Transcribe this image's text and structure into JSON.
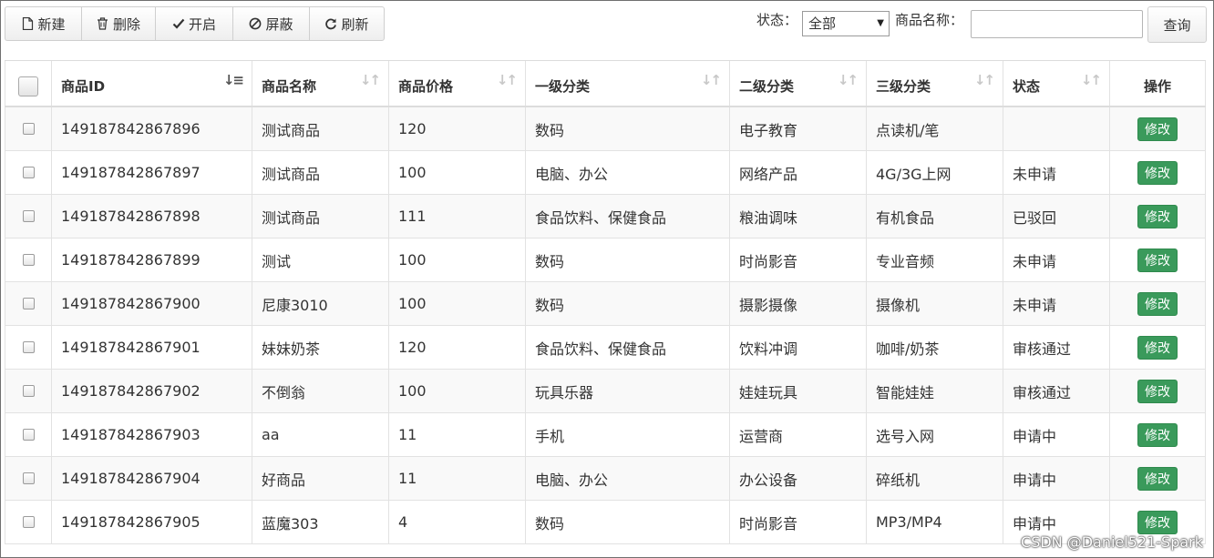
{
  "toolbar": {
    "buttons": [
      {
        "label": "新建",
        "icon": "file-icon"
      },
      {
        "label": "删除",
        "icon": "trash-icon"
      },
      {
        "label": "开启",
        "icon": "check-icon"
      },
      {
        "label": "屏蔽",
        "icon": "ban-icon"
      },
      {
        "label": "刷新",
        "icon": "refresh-icon"
      }
    ]
  },
  "filter": {
    "status_label": "状态：",
    "status_value": "全部",
    "name_label": "商品名称：",
    "name_value": "",
    "query_label": "查询"
  },
  "table": {
    "headers": [
      "商品ID",
      "商品名称",
      "商品价格",
      "一级分类",
      "二级分类",
      "三级分类",
      "状态",
      "操作"
    ],
    "edit_label": "修改",
    "rows": [
      {
        "id": "149187842867896",
        "name": "测试商品",
        "price": "120",
        "cat1": "数码",
        "cat2": "电子教育",
        "cat3": "点读机/笔",
        "status": ""
      },
      {
        "id": "149187842867897",
        "name": "测试商品",
        "price": "100",
        "cat1": "电脑、办公",
        "cat2": "网络产品",
        "cat3": "4G/3G上网",
        "status": "未申请"
      },
      {
        "id": "149187842867898",
        "name": "测试商品",
        "price": "111",
        "cat1": "食品饮料、保健食品",
        "cat2": "粮油调味",
        "cat3": "有机食品",
        "status": "已驳回"
      },
      {
        "id": "149187842867899",
        "name": "测试",
        "price": "100",
        "cat1": "数码",
        "cat2": "时尚影音",
        "cat3": "专业音频",
        "status": "未申请"
      },
      {
        "id": "149187842867900",
        "name": "尼康3010",
        "price": "100",
        "cat1": "数码",
        "cat2": "摄影摄像",
        "cat3": "摄像机",
        "status": "未申请"
      },
      {
        "id": "149187842867901",
        "name": "妹妹奶茶",
        "price": "120",
        "cat1": "食品饮料、保健食品",
        "cat2": "饮料冲调",
        "cat3": "咖啡/奶茶",
        "status": "审核通过"
      },
      {
        "id": "149187842867902",
        "name": "不倒翁",
        "price": "100",
        "cat1": "玩具乐器",
        "cat2": "娃娃玩具",
        "cat3": "智能娃娃",
        "status": "审核通过"
      },
      {
        "id": "149187842867903",
        "name": "aa",
        "price": "11",
        "cat1": "手机",
        "cat2": "运营商",
        "cat3": "选号入网",
        "status": "申请中"
      },
      {
        "id": "149187842867904",
        "name": "好商品",
        "price": "11",
        "cat1": "电脑、办公",
        "cat2": "办公设备",
        "cat3": "碎纸机",
        "status": "申请中"
      },
      {
        "id": "149187842867905",
        "name": "蓝魔303",
        "price": "4",
        "cat1": "数码",
        "cat2": "时尚影音",
        "cat3": "MP3/MP4",
        "status": "申请中"
      }
    ]
  },
  "watermark": "CSDN @Daniel521-Spark",
  "colors": {
    "edit_button": "#3a9a5b",
    "row_alt": "#f9f9f9"
  }
}
